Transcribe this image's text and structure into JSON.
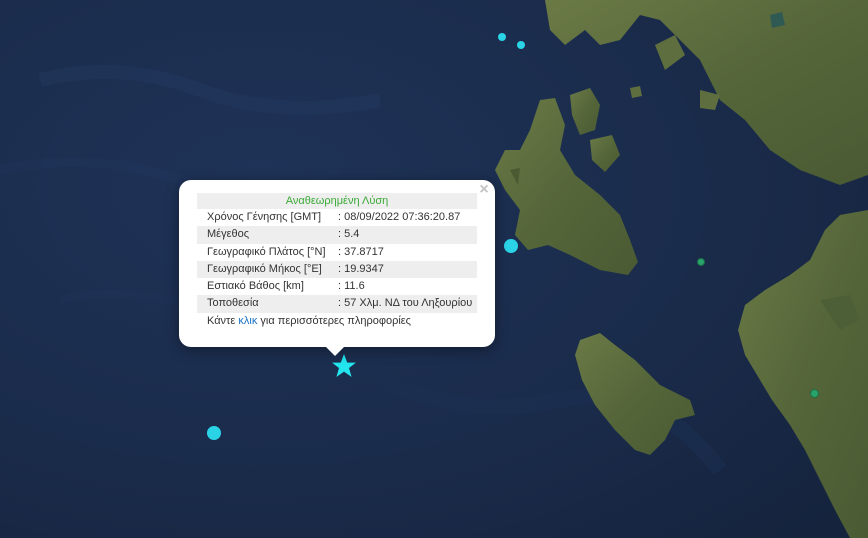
{
  "popup": {
    "title": "Αναθεωρημένη Λύση",
    "close_label": "×",
    "rows": [
      {
        "label": "Χρόνος Γένησης [GMT]",
        "value": ": 08/09/2022 07:36:20.87"
      },
      {
        "label": "Μέγεθος",
        "value": ": 5.4"
      },
      {
        "label": "Γεωγραφικό Πλάτος [°N]",
        "value": ": 37.8717"
      },
      {
        "label": "Γεωγραφικό Μήκος [°E]",
        "value": ": 19.9347"
      },
      {
        "label": "Εστιακό Βάθος [km]",
        "value": ": 11.6"
      },
      {
        "label": "Τοποθεσία",
        "value": ": 57 Χλμ. ΝΔ του Ληξουρίου"
      }
    ],
    "more_prefix": "Κάντε ",
    "more_link": "κλικ",
    "more_suffix": " για περισσότερες πληροφορίες"
  },
  "colors": {
    "sea": "#1a2b4a",
    "land": "#5b6b3c",
    "quake_recent": "#2ad4e6",
    "quake_older": "#2aa36a",
    "epicenter": "#22e5ee",
    "title_green": "#3aaa35",
    "link_blue": "#1a73c8"
  },
  "markers": {
    "epicenter_icon": "star-icon"
  }
}
